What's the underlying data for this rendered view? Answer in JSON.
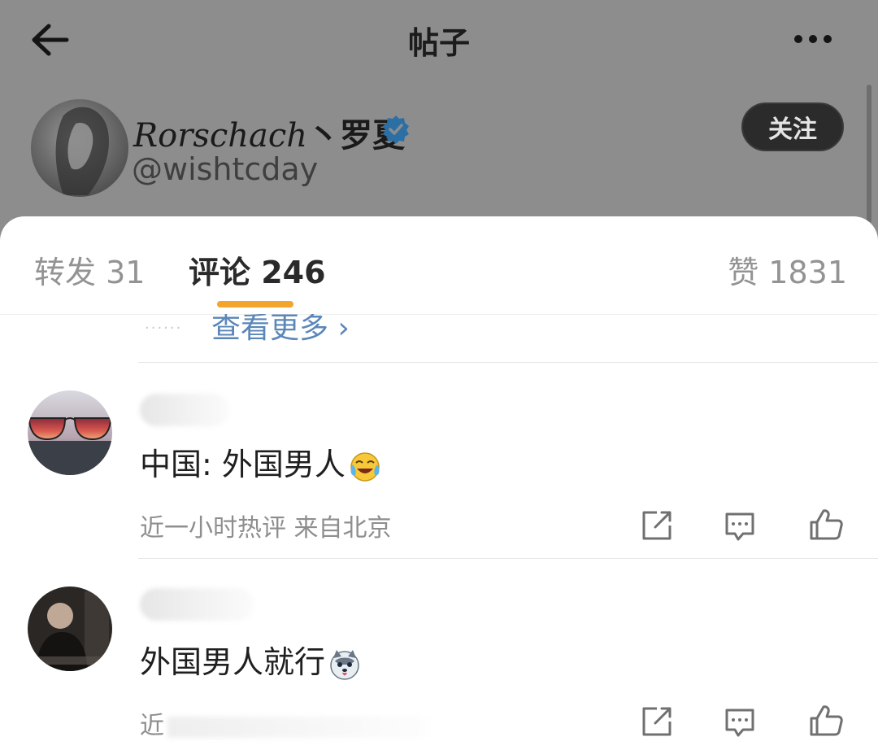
{
  "header": {
    "title": "帖子"
  },
  "author": {
    "name_latin": "Rorschach",
    "name_cn": "丶罗夏",
    "handle": "@wishtcday",
    "follow_label": "关注"
  },
  "tabs": {
    "repost": "转发 31",
    "comments": "评论 246",
    "likes": "赞 1831"
  },
  "replies": {
    "dots": "......",
    "view_more": "查看更多 ›"
  },
  "comments": [
    {
      "text": "中国: 外国男人",
      "emoji": "laugh-cry-emoji",
      "meta": "近一小时热评  来自北京"
    },
    {
      "text": "外国男人就行",
      "emoji": "husky-emoji",
      "meta": "近"
    }
  ],
  "colors": {
    "accent": "#f2a42c",
    "link": "#5b86b8",
    "verified": "#3a86c7"
  }
}
